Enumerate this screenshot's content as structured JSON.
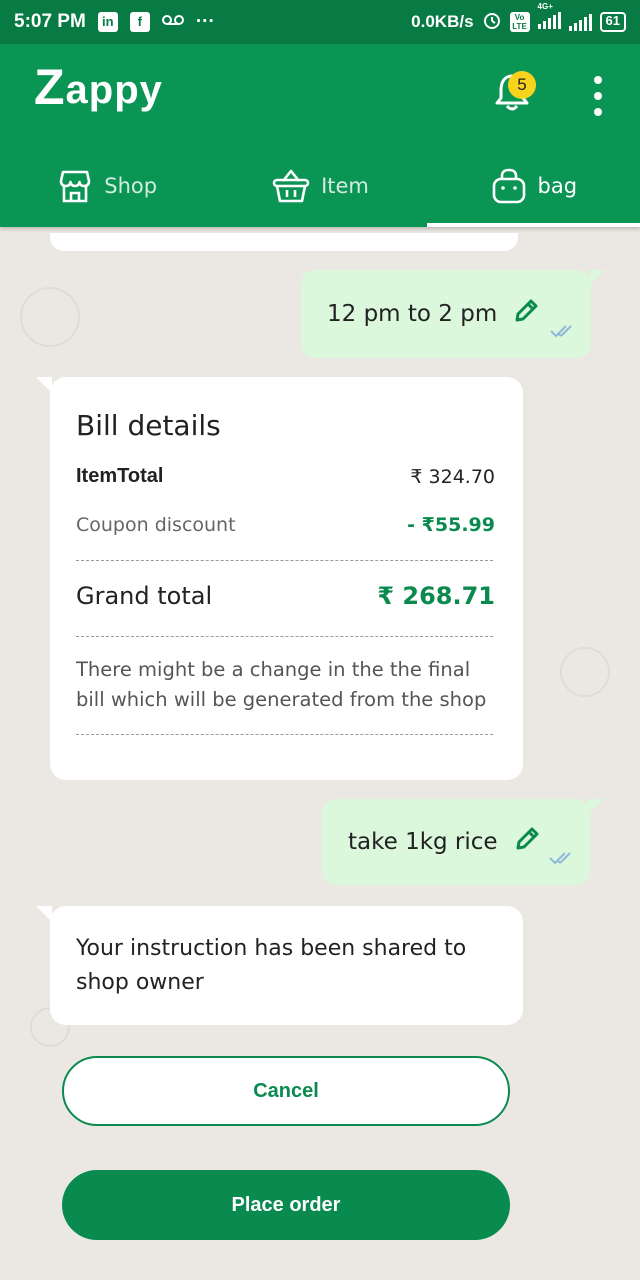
{
  "status_bar": {
    "time": "5:07 PM",
    "app_icons": [
      "linkedin-icon",
      "facebook-icon",
      "voicemail-icon"
    ],
    "more": "···",
    "net_speed": "0.0KB/s",
    "network_type": "4G+",
    "volte": "Vo LTE",
    "battery": "61"
  },
  "app_bar": {
    "logo_z": "Z",
    "logo_rest": "appy",
    "notification_count": "5",
    "tabs": [
      {
        "label": "Shop",
        "icon": "store-icon"
      },
      {
        "label": "Item",
        "icon": "basket-icon"
      },
      {
        "label": "bag",
        "icon": "shopping-bag-icon",
        "active": true
      }
    ]
  },
  "chat": {
    "delivery_slot": "12 pm to 2 pm",
    "bill": {
      "title": "Bill details",
      "item_total_label": "ItemTotal",
      "item_total_value": "₹ 324.70",
      "coupon_label": "Coupon discount",
      "coupon_value": "- ₹55.99",
      "grand_total_label": "Grand total",
      "grand_total_value": "₹ 268.71",
      "note": "There might be a change in the the final bill which will be generated from the shop"
    },
    "instruction": "take 1kg rice",
    "reply": "Your instruction has been shared to shop owner"
  },
  "actions": {
    "cancel_label": "Cancel",
    "place_order_label": "Place order"
  },
  "colors": {
    "brand_green": "#0b9555",
    "status_green": "#087a44",
    "accent_text_green": "#0b8a4f",
    "badge_yellow": "#f7d31c",
    "outgoing_bubble": "#dcf8dc"
  }
}
